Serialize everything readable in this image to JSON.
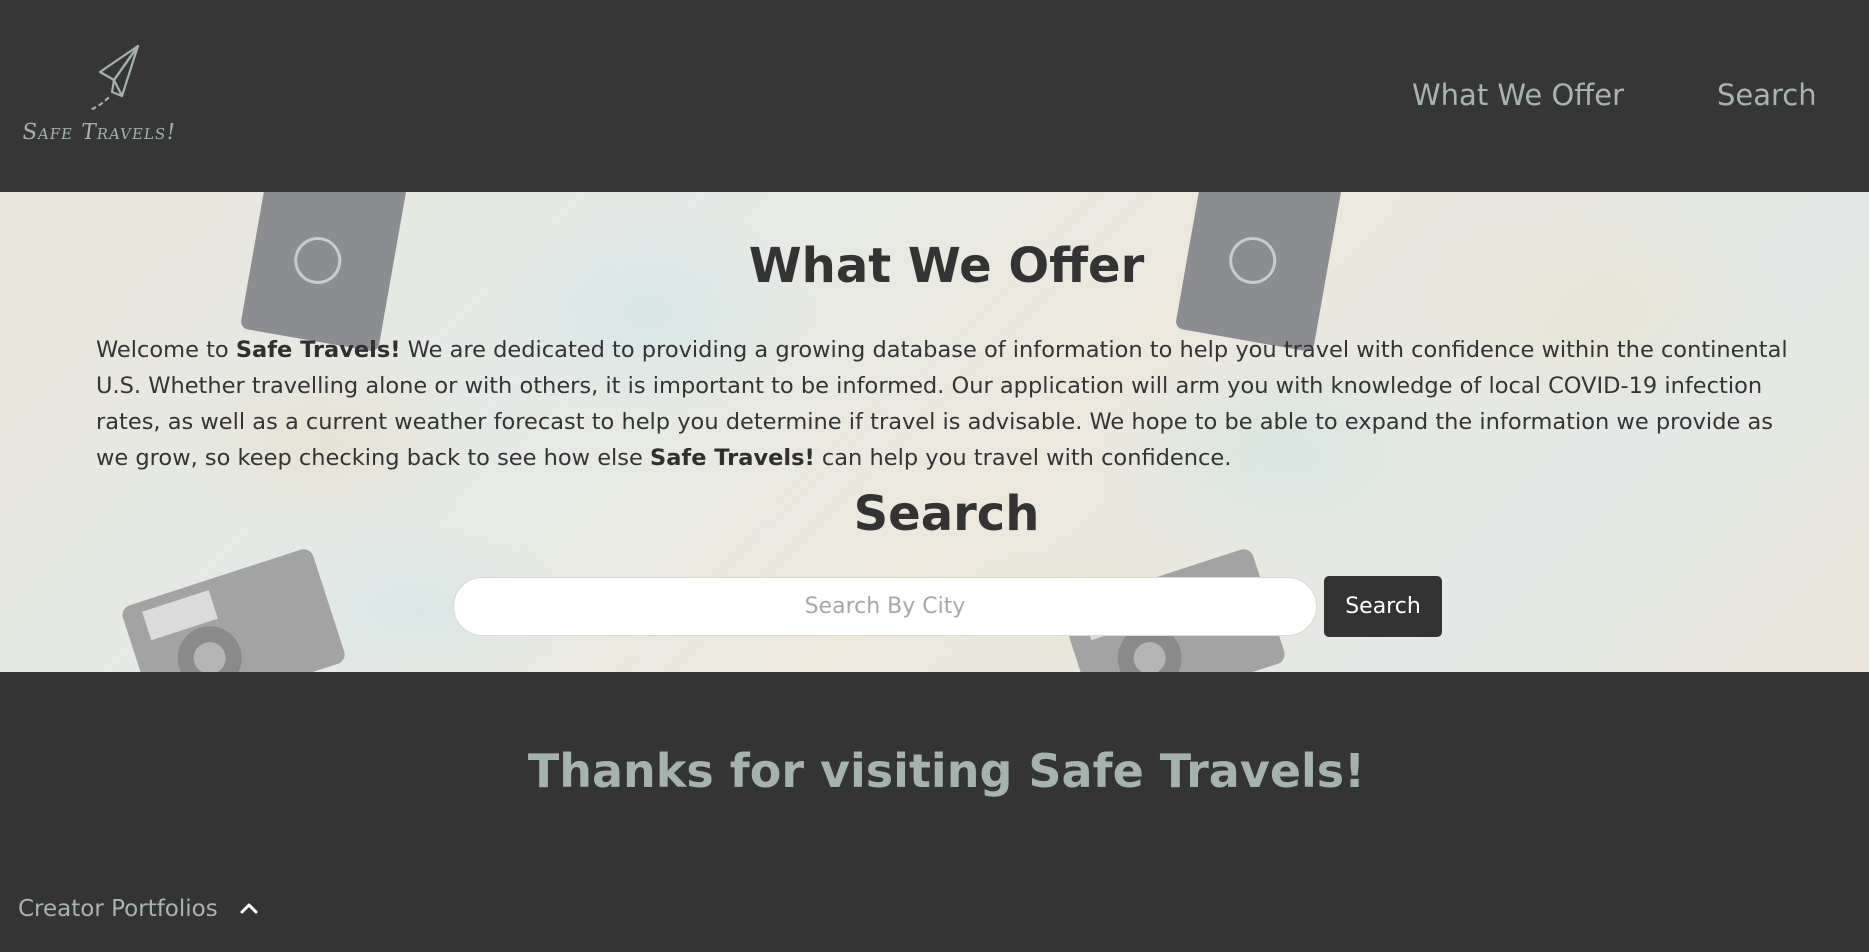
{
  "header": {
    "logo_text": "Safe Travels!",
    "logo_icon": "paper-plane-icon",
    "nav": {
      "what_we_offer": "What We Offer",
      "search": "Search"
    }
  },
  "hero": {
    "title": "What We Offer",
    "paragraph": {
      "welcome": "Welcome to ",
      "brand": "Safe Travels!",
      "body": " We are dedicated to providing a growing database of information to help you travel with confidence within the continental U.S. Whether travelling alone or with others, it is important to be informed. Our application will arm you with knowledge of local COVID-19 infection rates, as well as a current weather forecast to help you determine if travel is advisable. We hope to be able to expand the information we provide as we grow, so keep checking back to see how else ",
      "brand_again": "Safe Travels!",
      "closing": " can help you travel with confidence."
    },
    "search_title": "Search",
    "search_placeholder": "Search By City",
    "search_button": "Search"
  },
  "footer": {
    "thanks": "Thanks for visiting Safe Travels!",
    "portfolios_label": "Creator Portfolios",
    "portfolios_icon": "chevron-up-icon"
  },
  "colors": {
    "background": "#343434",
    "nav_text": "#a7b4b1",
    "hero_text": "#333333",
    "button_bg": "#333333",
    "button_text": "#ffffff"
  }
}
